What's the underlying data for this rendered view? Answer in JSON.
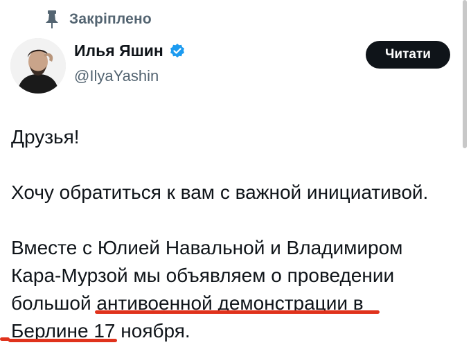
{
  "pinned": {
    "label": "Закріплено",
    "icon": "pin-icon"
  },
  "author": {
    "name": "Илья Яшин",
    "handle": "@IlyaYashin",
    "verified_icon": "verified-badge-icon",
    "verified_color": "#1d9bf0"
  },
  "follow_button": {
    "label": "Читати"
  },
  "tweet": {
    "line1": "Друзья!",
    "line2": "Хочу обратиться к вам с важной инициативой.",
    "para3_line1": "Вместе с Юлией Навальной и Владимиром",
    "para3_line2": "Кара-Мурзой мы объявляем о проведении",
    "para3_line3": "большой антивоенной демонстрации в",
    "para3_line4": "Берлине 17 ноября."
  },
  "colors": {
    "text": "#0f1419",
    "secondary": "#536471",
    "underline": "#e0321c"
  }
}
